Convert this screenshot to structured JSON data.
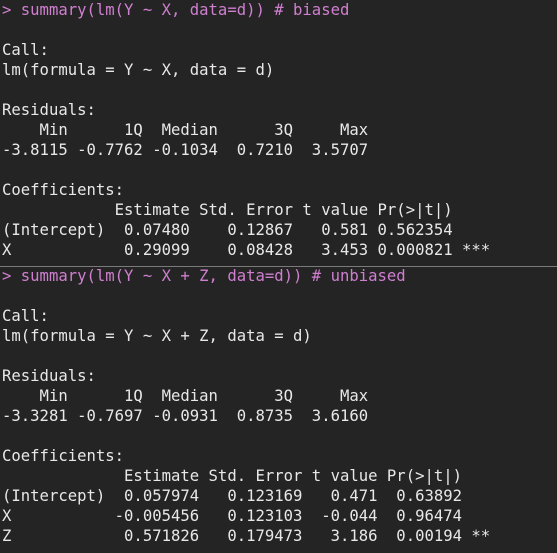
{
  "colors": {
    "background": "#242424",
    "text": "#e8e8e8",
    "command": "#d07fd0",
    "divider": "#7a7a7a"
  },
  "panel1": {
    "command": "> summary(lm(Y ~ X, data=d)) # biased",
    "call_label": "Call:",
    "call_formula": "lm(formula = Y ~ X, data = d)",
    "residuals_label": "Residuals:",
    "residuals_header": "    Min      1Q  Median      3Q     Max ",
    "residuals_values": "-3.8115 -0.7762 -0.1034  0.7210  3.5707 ",
    "coefficients_label": "Coefficients:",
    "coef_header": "            Estimate Std. Error t value Pr(>|t|)    ",
    "coef_rows": [
      "(Intercept)  0.07480    0.12867   0.581 0.562354    ",
      "X            0.29099    0.08428   3.453 0.000821 ***"
    ]
  },
  "panel2": {
    "command": "> summary(lm(Y ~ X + Z, data=d)) # unbiased",
    "call_label": "Call:",
    "call_formula": "lm(formula = Y ~ X + Z, data = d)",
    "residuals_label": "Residuals:",
    "residuals_header": "    Min      1Q  Median      3Q     Max ",
    "residuals_values": "-3.3281 -0.7697 -0.0931  0.8735  3.6160 ",
    "coefficients_label": "Coefficients:",
    "coef_header": "             Estimate Std. Error t value Pr(>|t|)   ",
    "coef_rows": [
      "(Intercept)  0.057974   0.123169   0.471  0.63892   ",
      "X           -0.005456   0.123103  -0.044  0.96474   ",
      "Z            0.571826   0.179473   3.186  0.00194 **"
    ]
  }
}
